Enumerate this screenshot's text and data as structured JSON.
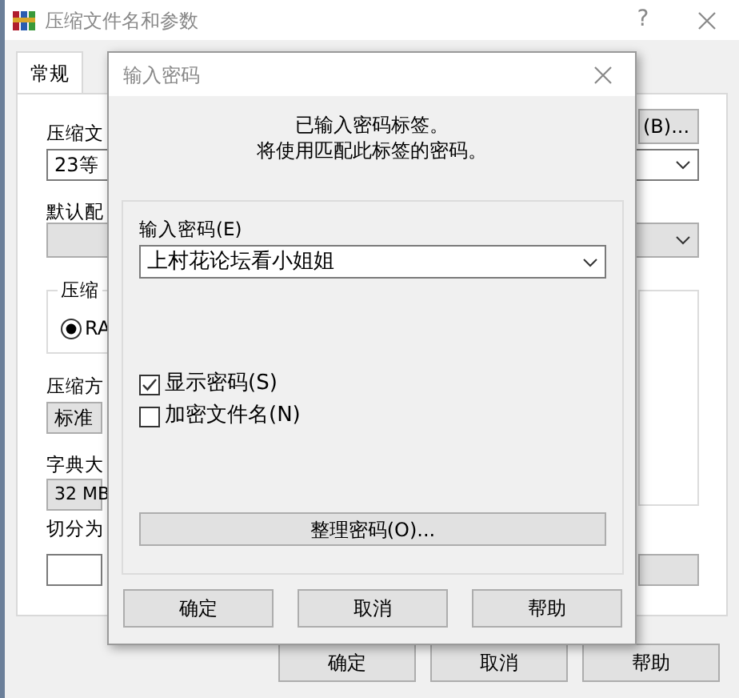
{
  "back_window": {
    "title": "压缩文件名和参数",
    "help_button": "?",
    "tabs": [
      {
        "label": "常规",
        "selected": true
      }
    ],
    "archive_name_label": "压缩文",
    "browse_button": "(B)...",
    "archive_name_value": "23等",
    "profile_label": "默认配",
    "format_group_label": "压缩",
    "format_radio": {
      "label": "RA",
      "selected": true
    },
    "method_label": "压缩方",
    "method_value": "标准",
    "dictionary_label": "字典大",
    "dictionary_value": "32 MB",
    "split_label": "切分为",
    "buttons": [
      "确定",
      "取消",
      "帮助"
    ]
  },
  "dialog": {
    "title": "输入密码",
    "message_lines": [
      "已输入密码标签。",
      "将使用匹配此标签的密码。"
    ],
    "password_label": "输入密码(E)",
    "password_value": "上村花论坛看小姐姐",
    "options": [
      {
        "label": "显示密码(S)",
        "checked": true
      },
      {
        "label": "加密文件名(N)",
        "checked": false
      }
    ],
    "organize_button": "整理密码(O)...",
    "buttons": [
      "确定",
      "取消",
      "帮助"
    ]
  }
}
